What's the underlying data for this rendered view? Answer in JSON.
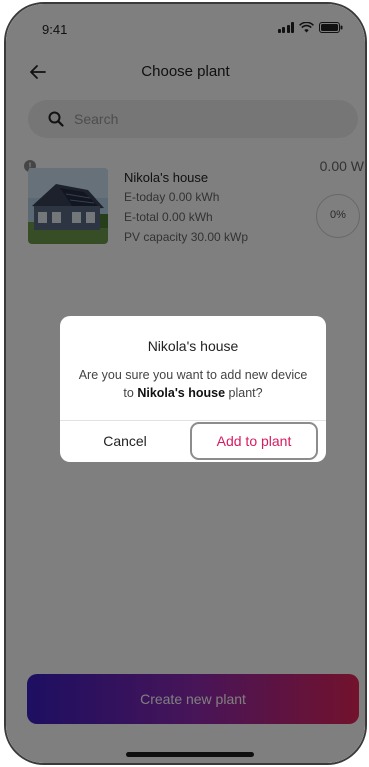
{
  "status_bar": {
    "time": "9:41"
  },
  "header": {
    "title": "Choose plant"
  },
  "search": {
    "placeholder": "Search",
    "value": ""
  },
  "plant": {
    "name": "Nikola's house",
    "e_today": "E-today 0.00 kWh",
    "e_total": "E-total 0.00 kWh",
    "pv_capacity": "PV capacity 30.00 kWp",
    "power": "0.00 W",
    "progress": "0%"
  },
  "dialog": {
    "title": "Nikola's house",
    "message_prefix": "Are you sure you want to add new device to ",
    "message_plant": "Nikola's house",
    "message_suffix": " plant?",
    "cancel_label": "Cancel",
    "confirm_label": "Add to plant"
  },
  "footer": {
    "create_label": "Create new plant"
  },
  "colors": {
    "accent": "#d81b60",
    "gradient_start": "#3b1ec4",
    "gradient_end": "#e5245a"
  },
  "icons": [
    "back-arrow-icon",
    "search-icon",
    "info-icon",
    "signal-icon",
    "wifi-icon",
    "battery-icon"
  ]
}
